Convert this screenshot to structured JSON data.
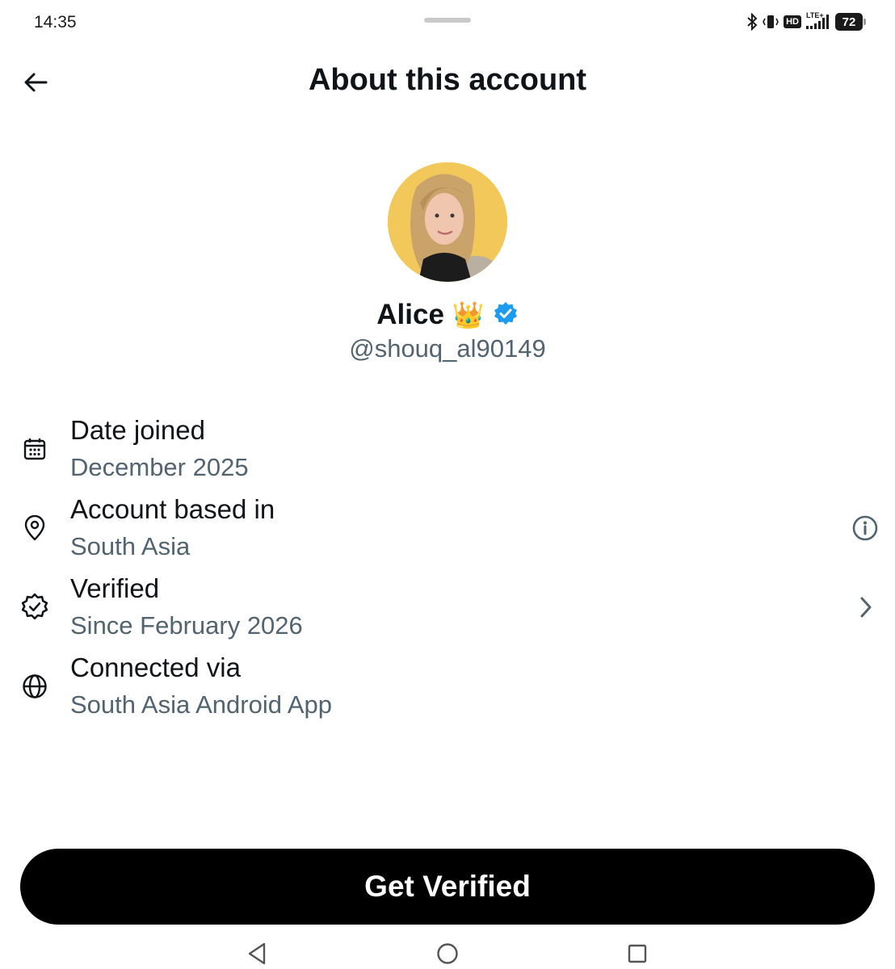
{
  "status_bar": {
    "time": "14:35",
    "network_label": "LTE+",
    "hd_label": "HD",
    "battery": "72",
    "icons": [
      "bluetooth-icon",
      "vibrate-icon",
      "hd-icon",
      "signal-icon",
      "battery-icon"
    ]
  },
  "header": {
    "title": "About this account",
    "back_icon": "arrow-left-icon"
  },
  "profile": {
    "display_name": "Alice",
    "name_emoji": "👑",
    "verified_badge_color": "#1d9bf0",
    "handle": "@shouq_al90149",
    "avatar_background": "#f3c85a"
  },
  "details": [
    {
      "icon": "calendar-icon",
      "label": "Date joined",
      "value": "December 2025",
      "action": null
    },
    {
      "icon": "location-pin-icon",
      "label": "Account based in",
      "value": "South Asia",
      "action": "info-icon"
    },
    {
      "icon": "verified-badge-icon",
      "label": "Verified",
      "value": "Since February 2026",
      "action": "chevron-right-icon"
    },
    {
      "icon": "globe-icon",
      "label": "Connected via",
      "value": "South Asia Android App",
      "action": null
    }
  ],
  "cta": {
    "label": "Get Verified"
  },
  "nav_bar": {
    "icons": [
      "back-triangle-icon",
      "home-circle-icon",
      "recents-square-icon"
    ]
  },
  "colors": {
    "text": "#0f1419",
    "secondary_text": "#536471",
    "button": "#000000"
  }
}
